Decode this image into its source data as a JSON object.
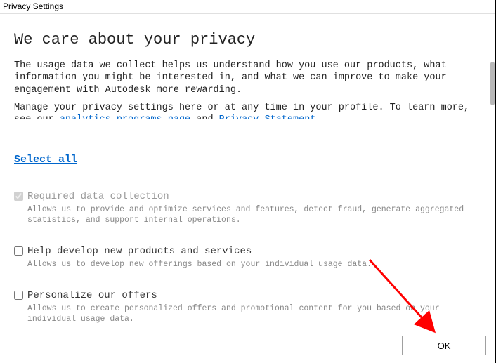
{
  "window": {
    "title": "Privacy Settings"
  },
  "heading": "We care about your privacy",
  "intro1": "The usage data we collect helps us understand how you use our products, what information you might be interested in, and what we can improve to make your engagement with Autodesk more rewarding.",
  "intro2_pre": "Manage your privacy settings here or at any time in your profile. To learn more, see our ",
  "intro2_link1": "analytics programs page",
  "intro2_mid": " and ",
  "intro2_link2": "Privacy Statement",
  "intro2_post": ".",
  "select_all": "Select all",
  "options": {
    "required": {
      "title": "Required data collection",
      "desc": "Allows us to provide and optimize services and features, detect fraud, generate aggregated statistics, and support internal operations."
    },
    "develop": {
      "title": "Help develop new products and services",
      "desc": "Allows us to develop new offerings based on your individual usage data."
    },
    "personalize": {
      "title": "Personalize our offers",
      "desc": "Allows us to create personalized offers and promotional content for you based on your individual usage data."
    }
  },
  "buttons": {
    "ok": "OK"
  }
}
